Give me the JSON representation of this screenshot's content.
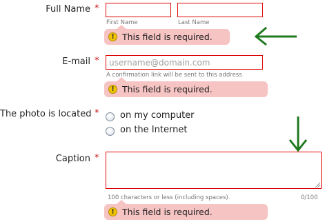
{
  "full_name": {
    "label": "Full Name",
    "required_mark": "*",
    "first_hint": "First Name",
    "last_hint": "Last Name",
    "error": "This field is required."
  },
  "email": {
    "label": "E-mail",
    "required_mark": "*",
    "placeholder": "username@domain.com",
    "hint": "A confirmation link will be sent to this address",
    "error": "This field is required."
  },
  "photo_location": {
    "label": "The photo is located",
    "required_mark": "*",
    "options": [
      {
        "label": "on my computer",
        "checked": false
      },
      {
        "label": "on the Internet",
        "checked": false
      }
    ]
  },
  "caption": {
    "label": "Caption",
    "required_mark": "*",
    "value": "",
    "hint": "100 characters or less (including spaces).",
    "counter": "0/100",
    "error": "This field is required."
  },
  "colors": {
    "required": "#cc1111",
    "error_border": "#e00000",
    "error_bubble": "#f7c4c4",
    "arrow": "#1f7a1f"
  },
  "icons": {
    "error_icon": "warning-icon",
    "annotation_arrow": "green-arrow"
  }
}
